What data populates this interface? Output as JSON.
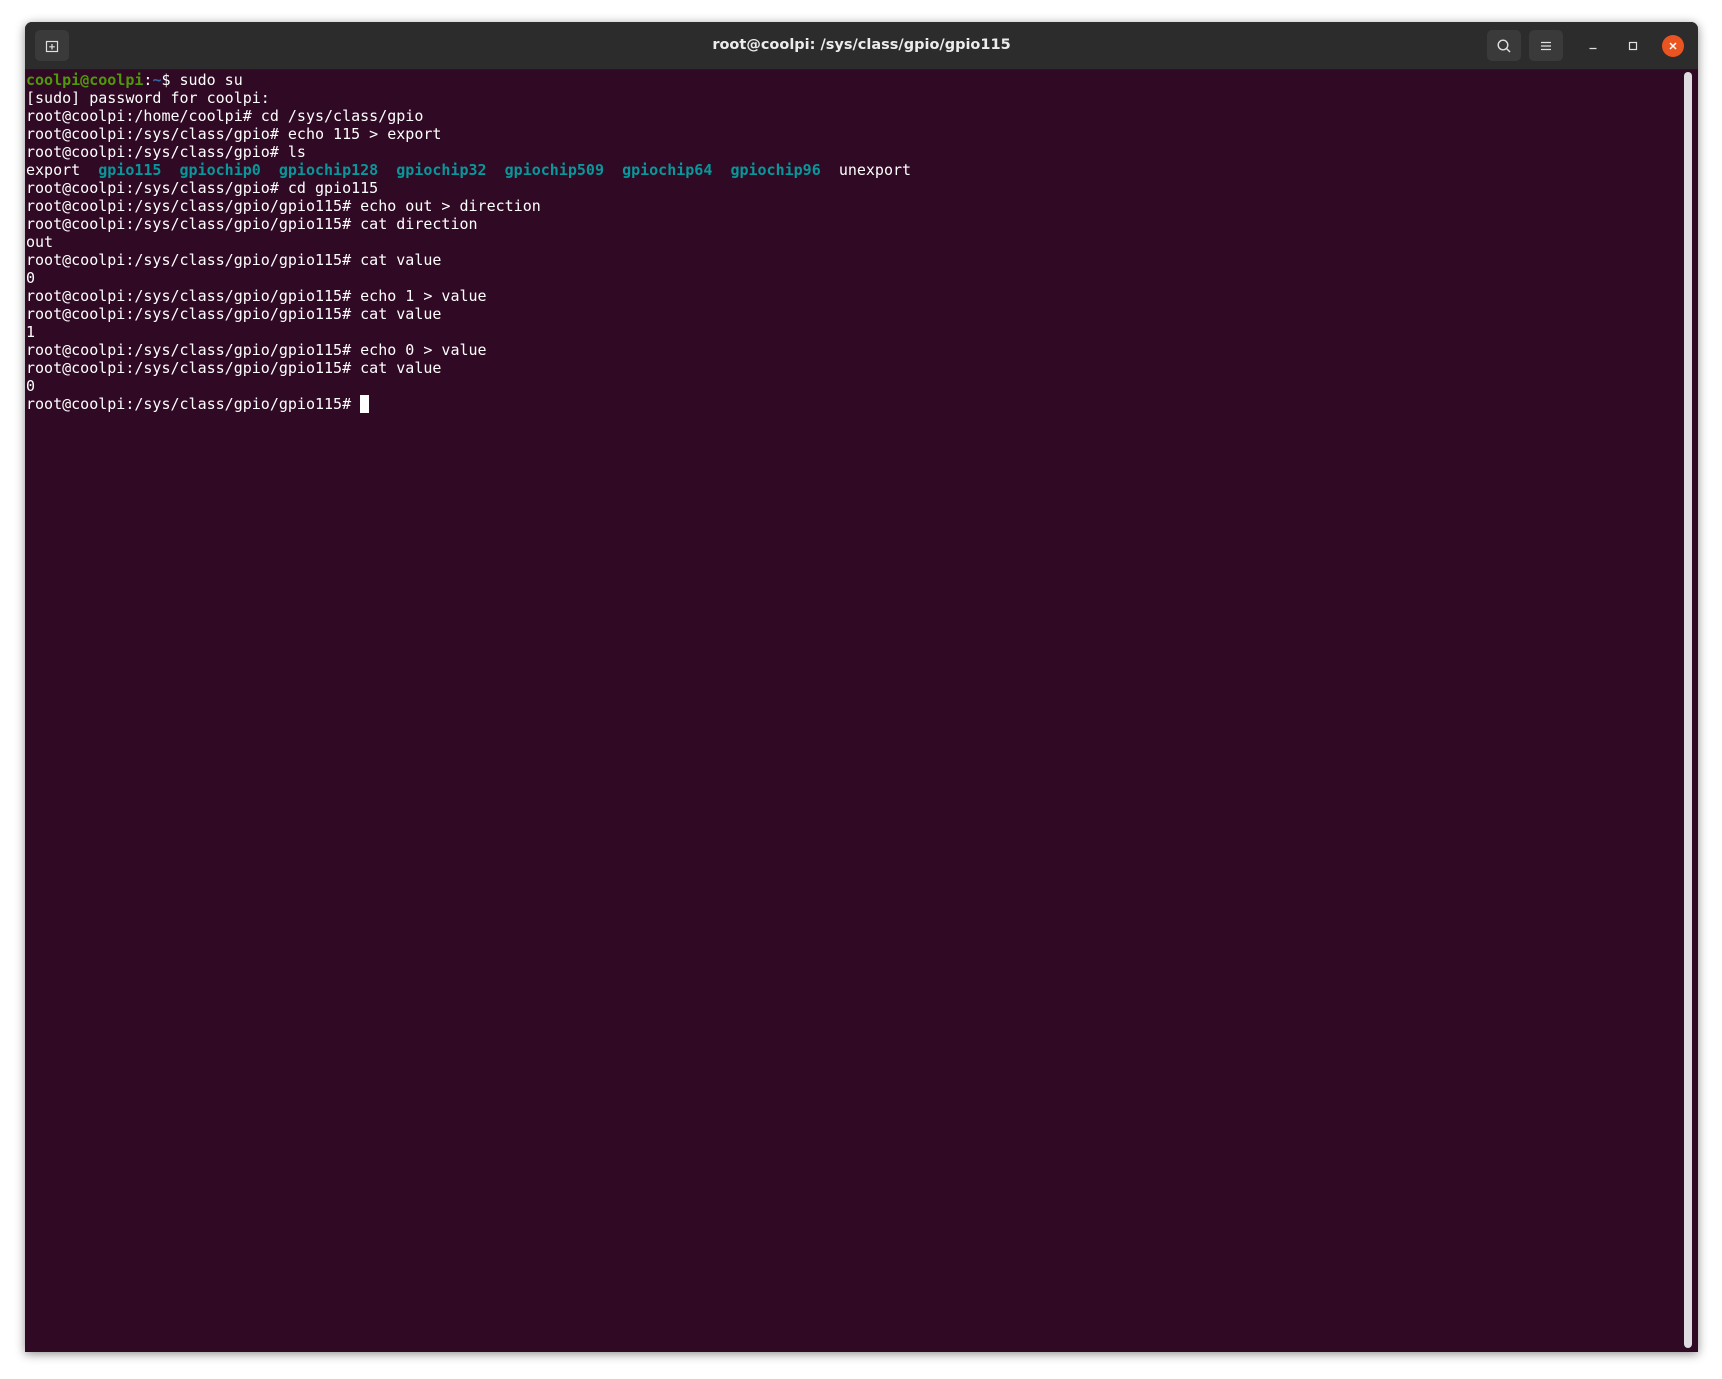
{
  "window": {
    "title": "root@coolpi: /sys/class/gpio/gpio115"
  },
  "titlebar": {
    "new_tab_icon": "new-tab-icon",
    "search_icon": "search-icon",
    "menu_icon": "hamburger-menu-icon",
    "minimize_icon": "minimize-icon",
    "maximize_icon": "maximize-icon",
    "close_icon": "close-icon"
  },
  "colors": {
    "background": "#300a24",
    "titlebar": "#2c2c2c",
    "user_prompt": "#4e9a06",
    "directory": "#06989a",
    "text": "#ffffff",
    "close_button": "#e95420"
  },
  "terminal": {
    "line0": {
      "user": "coolpi@coolpi",
      "colon": ":",
      "path": "~",
      "rest": "$ sudo su"
    },
    "line1": "[sudo] password for coolpi:",
    "line2": "root@coolpi:/home/coolpi# cd /sys/class/gpio",
    "line3": "root@coolpi:/sys/class/gpio# echo 115 > export",
    "line4": "root@coolpi:/sys/class/gpio# ls",
    "ls_output": {
      "export": "export",
      "sep1": "  ",
      "gpio115": "gpio115",
      "sep2": "  ",
      "gpiochip0": "gpiochip0",
      "sep3": "  ",
      "gpiochip128": "gpiochip128",
      "sep4": "  ",
      "gpiochip32": "gpiochip32",
      "sep5": "  ",
      "gpiochip509": "gpiochip509",
      "sep6": "  ",
      "gpiochip64": "gpiochip64",
      "sep7": "  ",
      "gpiochip96": "gpiochip96",
      "sep8": "  ",
      "unexport": "unexport"
    },
    "line6": "root@coolpi:/sys/class/gpio# cd gpio115",
    "line7": "root@coolpi:/sys/class/gpio/gpio115# echo out > direction",
    "line8": "root@coolpi:/sys/class/gpio/gpio115# cat direction",
    "line9": "out",
    "line10": "root@coolpi:/sys/class/gpio/gpio115# cat value",
    "line11": "0",
    "line12": "root@coolpi:/sys/class/gpio/gpio115# echo 1 > value",
    "line13": "root@coolpi:/sys/class/gpio/gpio115# cat value",
    "line14": "1",
    "line15": "root@coolpi:/sys/class/gpio/gpio115# echo 0 > value",
    "line16": "root@coolpi:/sys/class/gpio/gpio115# cat value",
    "line17": "0",
    "line18": "root@coolpi:/sys/class/gpio/gpio115# "
  }
}
